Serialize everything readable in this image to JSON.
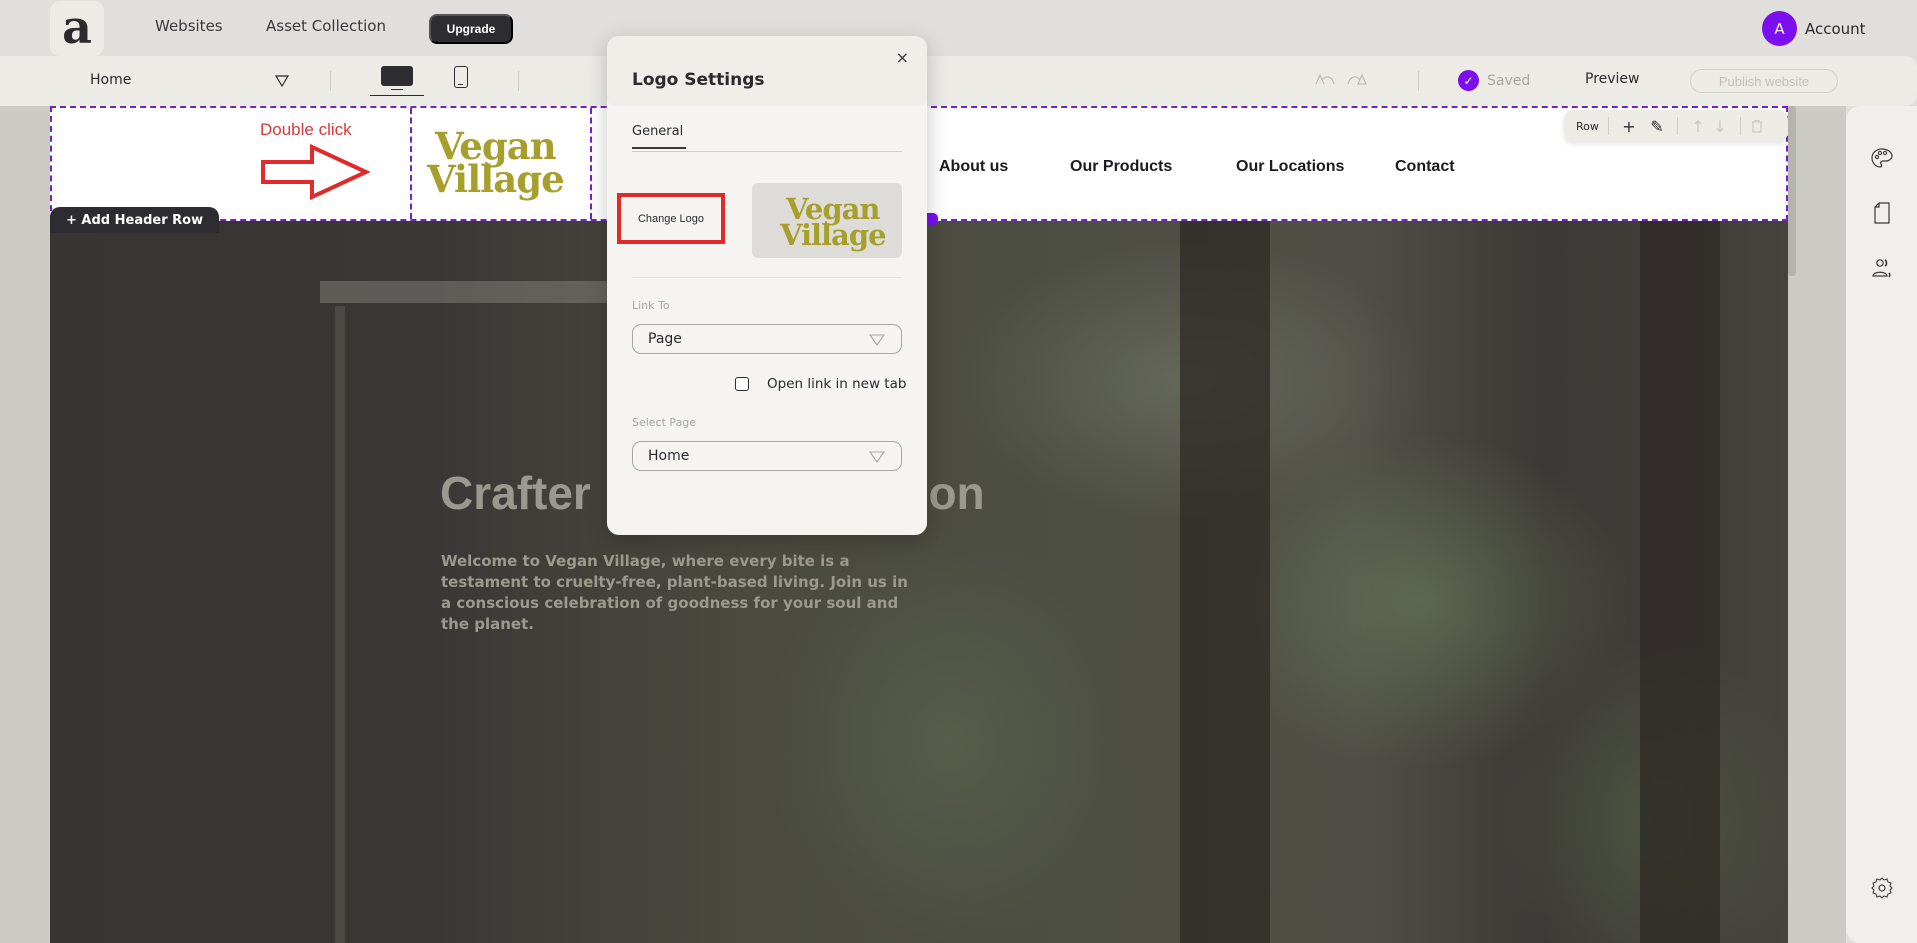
{
  "topbar": {
    "logo_glyph": "a",
    "nav": [
      "Websites",
      "Asset Collection"
    ],
    "upgrade_label": "Upgrade",
    "account": {
      "avatar_initial": "A",
      "label": "Account",
      "avatar_color": "#7a0ff0"
    }
  },
  "toolbar": {
    "page_select": "Home",
    "undo_icon": "undo-icon",
    "redo_icon": "redo-icon",
    "saved_label": "Saved",
    "saved_icon": "✓",
    "preview_label": "Preview",
    "publish_label": "Publish website",
    "devices": [
      "desktop",
      "mobile"
    ],
    "active_device": "desktop"
  },
  "canvas": {
    "hint": {
      "text": "Double click",
      "color": "#d43a3a"
    },
    "logo": {
      "line1": "Vegan",
      "line2": "Village",
      "color": "#a69f2c"
    },
    "nav_items": [
      "About us",
      "Our Products",
      "Our Locations",
      "Contact"
    ],
    "add_header_row_label": "+ Add Header Row",
    "row_toolbar": {
      "label": "Row",
      "add": "+",
      "edit": "✎",
      "up": "↑",
      "down": "↓",
      "delete": "🗑"
    },
    "hero": {
      "title_start": "Crafter",
      "title_end": "passion",
      "description": "Welcome to Vegan Village, where every bite is a testament to cruelty-free, plant-based living. Join us in a conscious celebration of goodness for your soul and the planet."
    },
    "selection_color": "#7620c8"
  },
  "modal": {
    "title": "Logo Settings",
    "close": "×",
    "tabs": [
      "General"
    ],
    "active_tab": "General",
    "change_logo_label": "Change Logo",
    "preview_logo": {
      "line1": "Vegan",
      "line2": "Village"
    },
    "link_to": {
      "label": "Link To",
      "value": "Page"
    },
    "open_new_tab": {
      "label": "Open link in new tab",
      "checked": false
    },
    "select_page": {
      "label": "Select Page",
      "value": "Home"
    }
  },
  "right_panel": {
    "icons": [
      "palette-icon",
      "page-icon",
      "users-icon",
      "settings-icon"
    ]
  }
}
